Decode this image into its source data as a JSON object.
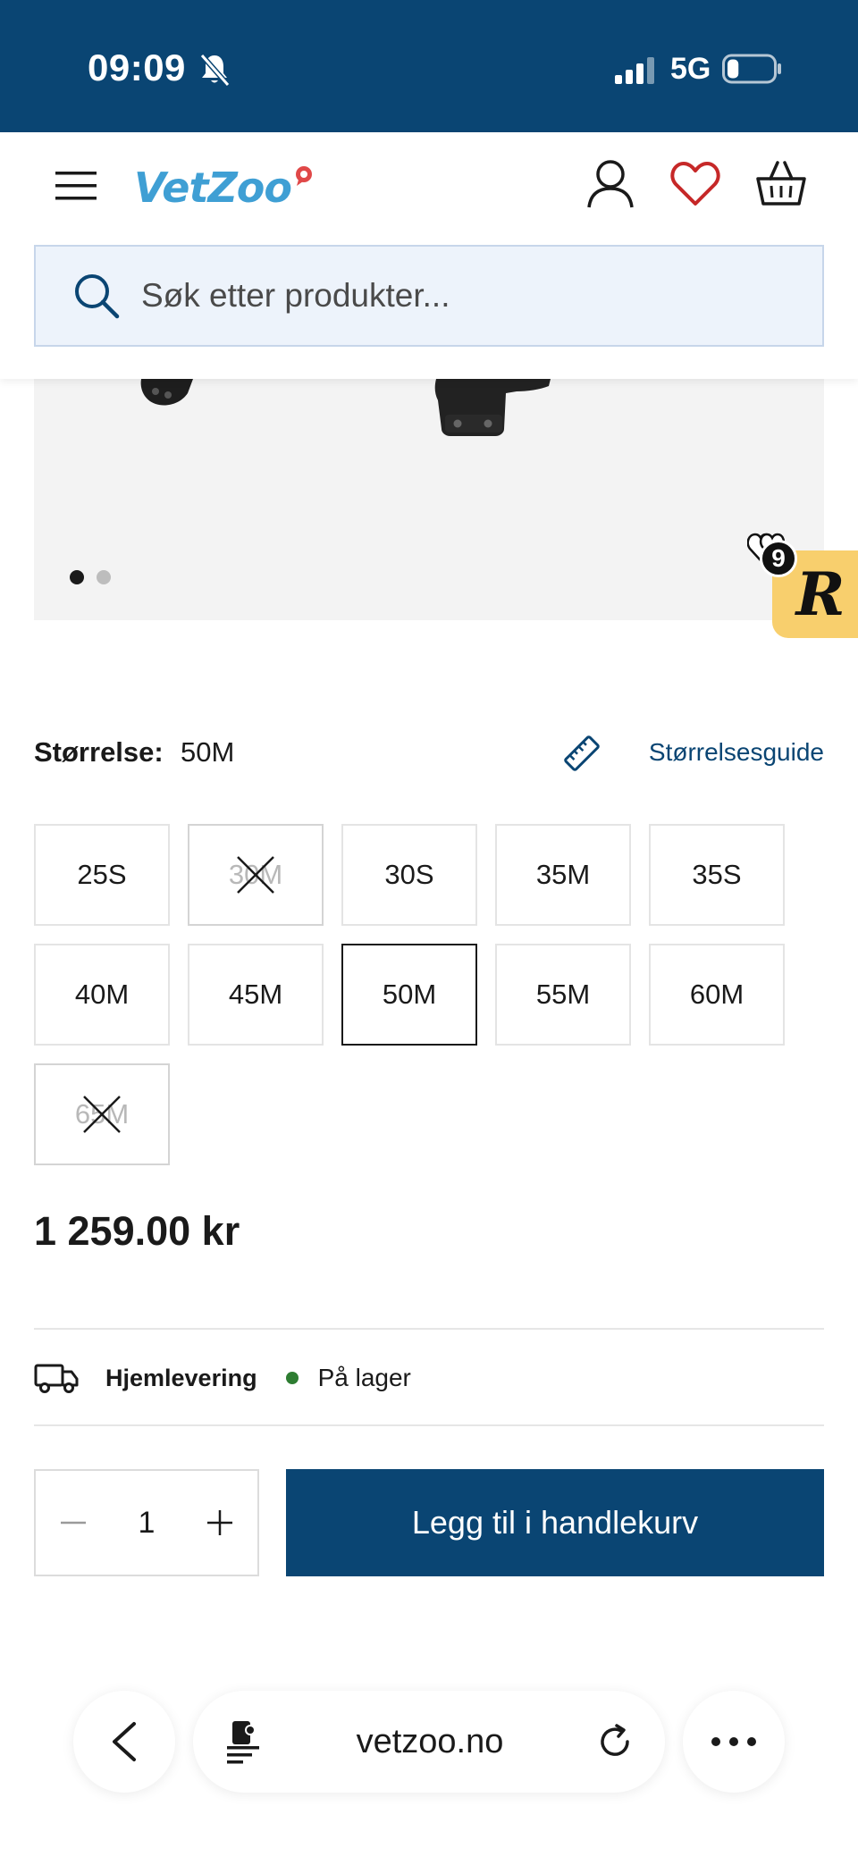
{
  "status_bar": {
    "time": "09:09",
    "network": "5G",
    "icons": [
      "bell-muted-icon",
      "signal-icon",
      "battery-icon"
    ],
    "battery_level": 0.25
  },
  "header": {
    "logo": "VetZoo",
    "icons": [
      "menu-icon",
      "user-icon",
      "heart-icon",
      "basket-icon"
    ],
    "search": {
      "placeholder": "Søk etter produkter..."
    }
  },
  "gallery": {
    "dots_total": 2,
    "active_dot": 1,
    "wishlist_count": "9",
    "badge_letter": "R"
  },
  "size": {
    "label": "Størrelse:",
    "selected": "50M",
    "guide_label": "Størrelsesguide",
    "options": [
      {
        "label": "25S",
        "available": true,
        "selected": false
      },
      {
        "label": "30M",
        "available": false,
        "selected": false
      },
      {
        "label": "30S",
        "available": true,
        "selected": false
      },
      {
        "label": "35M",
        "available": true,
        "selected": false
      },
      {
        "label": "35S",
        "available": true,
        "selected": false
      },
      {
        "label": "40M",
        "available": true,
        "selected": false
      },
      {
        "label": "45M",
        "available": true,
        "selected": false
      },
      {
        "label": "50M",
        "available": true,
        "selected": true
      },
      {
        "label": "55M",
        "available": true,
        "selected": false
      },
      {
        "label": "60M",
        "available": true,
        "selected": false
      },
      {
        "label": "65M",
        "available": false,
        "selected": false
      }
    ]
  },
  "price": "1 259.00 kr",
  "delivery": {
    "label": "Hjemlevering",
    "stock": "På lager",
    "stock_color": "#2e7d32"
  },
  "cart": {
    "quantity": "1",
    "add_label": "Legg til i handlekurv"
  },
  "browser": {
    "address": "vetzoo.no"
  },
  "colors": {
    "brand": "#0a4573",
    "logo": "#3f9fd4",
    "heart": "#c62828",
    "badge": "#f8cf6d"
  }
}
